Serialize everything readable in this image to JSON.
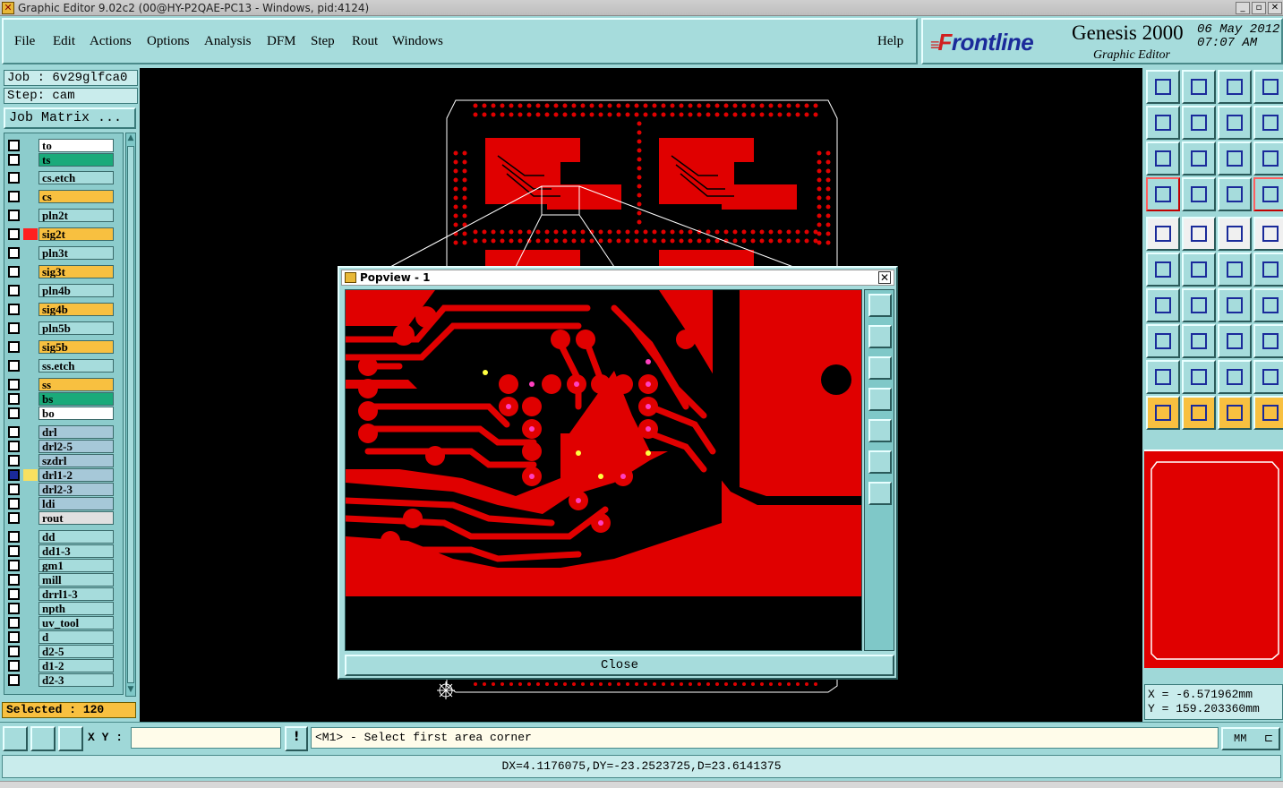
{
  "window": {
    "title": "Graphic Editor 9.02c2 (00@HY-P2QAE-PC13 - Windows, pid:4124)"
  },
  "menu": {
    "items": [
      "File",
      "Edit",
      "Actions",
      "Options",
      "Analysis",
      "DFM",
      "Step",
      "Rout",
      "Windows"
    ],
    "help": "Help"
  },
  "brand": {
    "logo_f": "F",
    "logo_rest": "rontline",
    "product": "Genesis 2000",
    "subtitle": "Graphic Editor",
    "date": "06 May 2012",
    "time": "07:07 AM"
  },
  "job": {
    "job_label": "Job : 6v29glfca0",
    "step_label": "Step: cam",
    "matrix_button": "Job Matrix ..."
  },
  "layers": [
    {
      "name": "to",
      "color": "#ffffff"
    },
    {
      "name": "ts",
      "color": "#1aaa7a"
    },
    {
      "name": "cs.etch",
      "color": "#a6dcdc"
    },
    {
      "name": "cs",
      "color": "#f8c040"
    },
    {
      "name": "pln2t",
      "color": "#a6dcdc"
    },
    {
      "name": "sig2t",
      "color": "#f8c040",
      "swatch": "#ff2020"
    },
    {
      "name": "pln3t",
      "color": "#a6dcdc"
    },
    {
      "name": "sig3t",
      "color": "#f8c040"
    },
    {
      "name": "pln4b",
      "color": "#a6dcdc"
    },
    {
      "name": "sig4b",
      "color": "#f8c040"
    },
    {
      "name": "pln5b",
      "color": "#a6dcdc"
    },
    {
      "name": "sig5b",
      "color": "#f8c040"
    },
    {
      "name": "ss.etch",
      "color": "#a6dcdc"
    },
    {
      "name": "ss",
      "color": "#f8c040"
    },
    {
      "name": "bs",
      "color": "#1aaa7a"
    },
    {
      "name": "bo",
      "color": "#ffffff"
    },
    {
      "name": "drl",
      "color": "#a6c8d8"
    },
    {
      "name": "drl2-5",
      "color": "#a6c8d8"
    },
    {
      "name": "szdrl",
      "color": "#a6c8d8"
    },
    {
      "name": "drl1-2",
      "color": "#a6c8d8",
      "swatch": "#f8e060",
      "active": true
    },
    {
      "name": "drl2-3",
      "color": "#a6c8d8"
    },
    {
      "name": "ldi",
      "color": "#a6c8d8"
    },
    {
      "name": "rout",
      "color": "#e0e0e0"
    },
    {
      "name": "dd",
      "color": "#a6dcdc"
    },
    {
      "name": "dd1-3",
      "color": "#a6dcdc"
    },
    {
      "name": "gm1",
      "color": "#a6dcdc"
    },
    {
      "name": "mill",
      "color": "#a6dcdc"
    },
    {
      "name": "drrl1-3",
      "color": "#a6dcdc"
    },
    {
      "name": "npth",
      "color": "#a6dcdc"
    },
    {
      "name": "uv_tool",
      "color": "#a6dcdc"
    },
    {
      "name": "d",
      "color": "#a6dcdc"
    },
    {
      "name": "d2-5",
      "color": "#a6dcdc"
    },
    {
      "name": "d1-2",
      "color": "#a6dcdc"
    },
    {
      "name": "d2-3",
      "color": "#a6dcdc"
    }
  ],
  "selected": "Selected : 120",
  "popview": {
    "title": "Popview - 1",
    "close_label": "Close"
  },
  "coords": {
    "x": "X = -6.571962mm",
    "y": "Y = 159.203360mm"
  },
  "command": {
    "xy_label": "X Y :",
    "xy_value": "",
    "prompt": "<M1> - Select first area corner",
    "units": "MM"
  },
  "status": "DX=4.1176075,DY=-23.2523725,D=23.6141375",
  "colors": {
    "copper": "#e00000",
    "panel": "#a6dcdc",
    "accent": "#f8c040"
  }
}
